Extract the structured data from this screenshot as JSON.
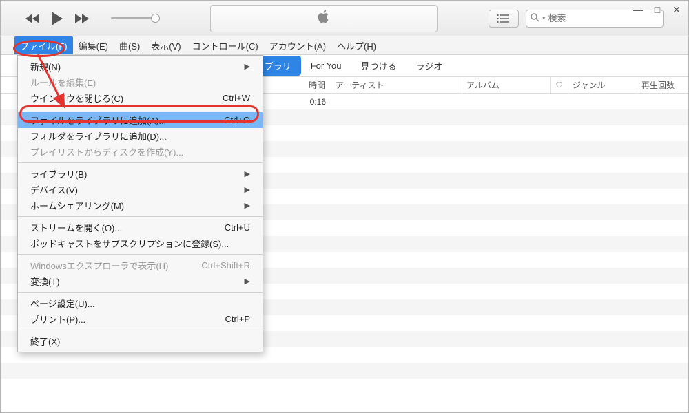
{
  "window_controls": {
    "min": "—",
    "max": "□",
    "close": "✕"
  },
  "search": {
    "placeholder": "検索"
  },
  "menubar": {
    "items": [
      "ファイル(F)",
      "編集(E)",
      "曲(S)",
      "表示(V)",
      "コントロール(C)",
      "アカウント(A)",
      "ヘルプ(H)"
    ],
    "active_index": 0
  },
  "tabs": {
    "items": [
      "ライブラリ",
      "For You",
      "見つける",
      "ラジオ"
    ],
    "selected_index": 0
  },
  "columns": {
    "time": "時間",
    "artist": "アーティスト",
    "album": "アルバム",
    "heart": "♡",
    "genre": "ジャンル",
    "plays": "再生回数"
  },
  "rows": [
    {
      "time": "0:16"
    }
  ],
  "dropdown": {
    "groups": [
      [
        {
          "label": "新規(N)",
          "submenu": true
        },
        {
          "label": "ルールを編集(E)",
          "disabled": true
        },
        {
          "label": "ウインドウを閉じる(C)",
          "shortcut": "Ctrl+W"
        }
      ],
      [
        {
          "label": "ファイルをライブラリに追加(A)...",
          "shortcut": "Ctrl+O",
          "highlight": true
        },
        {
          "label": "フォルダをライブラリに追加(D)..."
        },
        {
          "label": "プレイリストからディスクを作成(Y)...",
          "disabled": true
        }
      ],
      [
        {
          "label": "ライブラリ(B)",
          "submenu": true
        },
        {
          "label": "デバイス(V)",
          "submenu": true
        },
        {
          "label": "ホームシェアリング(M)",
          "submenu": true
        }
      ],
      [
        {
          "label": "ストリームを開く(O)...",
          "shortcut": "Ctrl+U"
        },
        {
          "label": "ポッドキャストをサブスクリプションに登録(S)..."
        }
      ],
      [
        {
          "label": "Windowsエクスプローラで表示(H)",
          "shortcut": "Ctrl+Shift+R",
          "disabled": true
        },
        {
          "label": "変換(T)",
          "submenu": true
        }
      ],
      [
        {
          "label": "ページ設定(U)..."
        },
        {
          "label": "プリント(P)...",
          "shortcut": "Ctrl+P"
        }
      ],
      [
        {
          "label": "終了(X)"
        }
      ]
    ]
  }
}
